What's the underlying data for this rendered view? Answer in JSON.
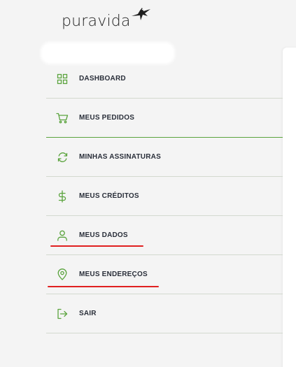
{
  "brand": {
    "name": "puravida",
    "accent_color": "#5aa33d"
  },
  "menu": {
    "items": [
      {
        "label": "DASHBOARD",
        "icon": "grid-icon"
      },
      {
        "label": "MEUS PEDIDOS",
        "icon": "cart-icon"
      },
      {
        "label": "MINHAS ASSINATURAS",
        "icon": "refresh-icon"
      },
      {
        "label": "MEUS CRÉDITOS",
        "icon": "dollar-icon"
      },
      {
        "label": "MEUS DADOS",
        "icon": "user-icon"
      },
      {
        "label": "MEUS ENDEREÇOS",
        "icon": "map-pin-icon"
      },
      {
        "label": "SAIR",
        "icon": "logout-icon"
      }
    ]
  },
  "annotations": {
    "underline_color": "#e02020"
  }
}
